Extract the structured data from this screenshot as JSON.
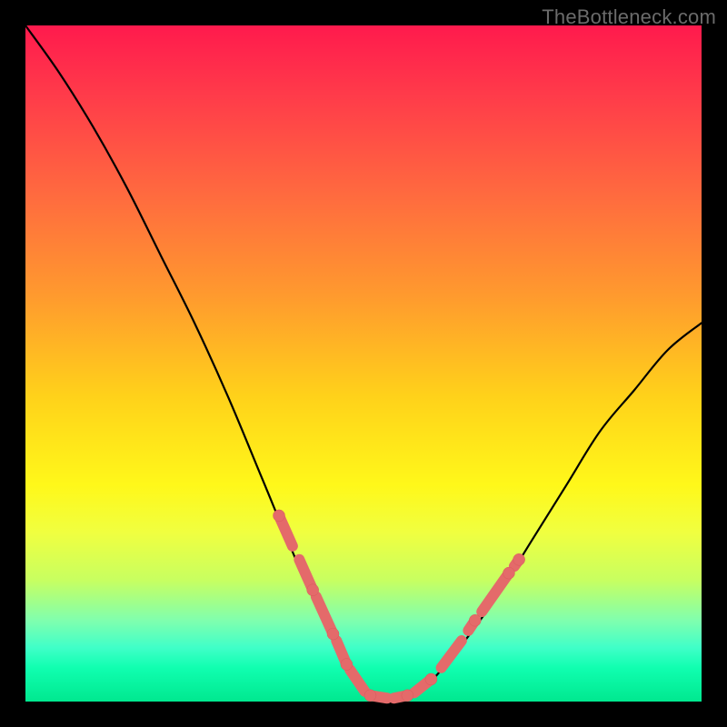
{
  "watermark": "TheBottleneck.com",
  "colors": {
    "gradient_top": "#ff1a4d",
    "gradient_bottom": "#00e88f",
    "curve": "#000000",
    "marker": "#e46a6a",
    "frame": "#000000"
  },
  "chart_data": {
    "type": "line",
    "title": "",
    "xlabel": "",
    "ylabel": "",
    "xlim": [
      0,
      1
    ],
    "ylim": [
      0,
      1
    ],
    "grid": false,
    "series": [
      {
        "name": "bottleneck-curve",
        "x": [
          0.0,
          0.05,
          0.1,
          0.15,
          0.2,
          0.25,
          0.3,
          0.35,
          0.4,
          0.45,
          0.475,
          0.5,
          0.525,
          0.55,
          0.575,
          0.6,
          0.65,
          0.7,
          0.75,
          0.8,
          0.85,
          0.9,
          0.95,
          1.0
        ],
        "y": [
          1.0,
          0.93,
          0.85,
          0.76,
          0.66,
          0.56,
          0.45,
          0.33,
          0.21,
          0.1,
          0.05,
          0.015,
          0.005,
          0.005,
          0.01,
          0.03,
          0.09,
          0.16,
          0.24,
          0.32,
          0.4,
          0.46,
          0.52,
          0.56
        ]
      }
    ],
    "markers": {
      "name": "highlight-segments",
      "segments": [
        {
          "x0": 0.375,
          "y0": 0.275,
          "x1": 0.395,
          "y1": 0.23
        },
        {
          "x0": 0.405,
          "y0": 0.21,
          "x1": 0.425,
          "y1": 0.165
        },
        {
          "x0": 0.43,
          "y0": 0.155,
          "x1": 0.455,
          "y1": 0.1
        },
        {
          "x0": 0.46,
          "y0": 0.09,
          "x1": 0.475,
          "y1": 0.055
        },
        {
          "x0": 0.48,
          "y0": 0.047,
          "x1": 0.502,
          "y1": 0.015
        },
        {
          "x0": 0.51,
          "y0": 0.009,
          "x1": 0.535,
          "y1": 0.005
        },
        {
          "x0": 0.545,
          "y0": 0.005,
          "x1": 0.565,
          "y1": 0.009
        },
        {
          "x0": 0.575,
          "y0": 0.013,
          "x1": 0.6,
          "y1": 0.033
        },
        {
          "x0": 0.615,
          "y0": 0.05,
          "x1": 0.645,
          "y1": 0.09
        },
        {
          "x0": 0.655,
          "y0": 0.105,
          "x1": 0.665,
          "y1": 0.12
        },
        {
          "x0": 0.675,
          "y0": 0.133,
          "x1": 0.715,
          "y1": 0.19
        },
        {
          "x0": 0.723,
          "y0": 0.2,
          "x1": 0.73,
          "y1": 0.21
        }
      ],
      "dots": [
        {
          "x": 0.375,
          "y": 0.275
        },
        {
          "x": 0.425,
          "y": 0.165
        },
        {
          "x": 0.455,
          "y": 0.1
        },
        {
          "x": 0.475,
          "y": 0.055
        },
        {
          "x": 0.51,
          "y": 0.009
        },
        {
          "x": 0.565,
          "y": 0.009
        },
        {
          "x": 0.6,
          "y": 0.033
        },
        {
          "x": 0.665,
          "y": 0.12
        },
        {
          "x": 0.715,
          "y": 0.19
        },
        {
          "x": 0.73,
          "y": 0.21
        }
      ],
      "radius": 6.5,
      "stroke_radius": 6.0
    }
  }
}
